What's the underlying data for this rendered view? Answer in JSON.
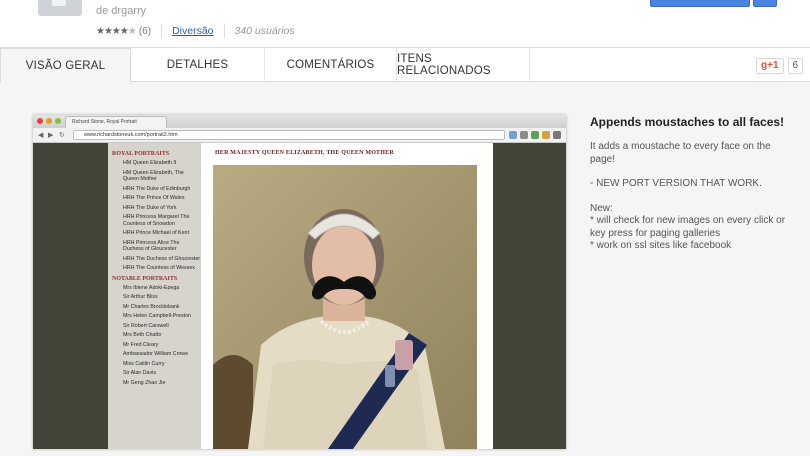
{
  "header": {
    "author": "de drgarry",
    "rating": {
      "stars_filled": 4,
      "stars_total": 5,
      "count": "(6)"
    },
    "category": "Diversão",
    "users": "340 usuários"
  },
  "tabs": [
    {
      "label": "VISÃO GERAL",
      "active": true
    },
    {
      "label": "DETALHES",
      "active": false
    },
    {
      "label": "COMENTÁRIOS",
      "active": false
    },
    {
      "label": "ITENS RELACIONADOS",
      "active": false
    }
  ],
  "gplus": {
    "label": "g+1",
    "count": "6"
  },
  "screenshot": {
    "tab_title": "Richard Stone, Royal Portrait",
    "url": "www.richardstoneuk.com/portrait2.htm",
    "sidebar": {
      "royal_heading": "ROYAL PORTRAITS",
      "royal_items": [
        "HM Queen Elizabeth II",
        "HM Queen Elizabeth, The Queen Mother",
        "HRH The Duke of Edinburgh",
        "HRH The Prince Of Wales",
        "HRH The Duke of York",
        "HRH Princess Margaret The Countess of Snowdon",
        "HRH Prince Michael of Kent",
        "HRH Princess Alice The Duchess of Gloucester",
        "HRH The Duchess of Gloucester",
        "HRH The Countess of Wessex"
      ],
      "notable_heading": "NOTABLE PORTRAITS",
      "notable_items": [
        "Mrs Ibiene Adoki-Epega",
        "Sir Arthur Bliss",
        "Mr Charles Brocklebank",
        "Mrs Helen Campbell-Preston",
        "Sir Robert Carswell",
        "Mrs Beth Chatto",
        "Mr Fred Cleary",
        "Ambassador William Crowe",
        "Miss Caitlin Curry",
        "Sir Alan Davis",
        "Mr Geng Zhao Jie"
      ]
    },
    "portrait_title": "HER MAJESTY QUEEN ELIZABETH, THE QUEEN MOTHER"
  },
  "description": {
    "title": "Appends moustaches to all faces!",
    "p1": "It adds a moustache to every face on the page!",
    "p2": "- NEW PORT VERSION THAT WORK.",
    "p3": "New:\n* will check for new images on every click or key press for paging galleries\n* work on ssl sites like facebook"
  },
  "colors": {
    "install_blue": "#4a83e0",
    "link_blue": "#2a5db0",
    "gplus_red": "#dd4b39",
    "sidebar_heading_red": "#9b2c2c"
  }
}
